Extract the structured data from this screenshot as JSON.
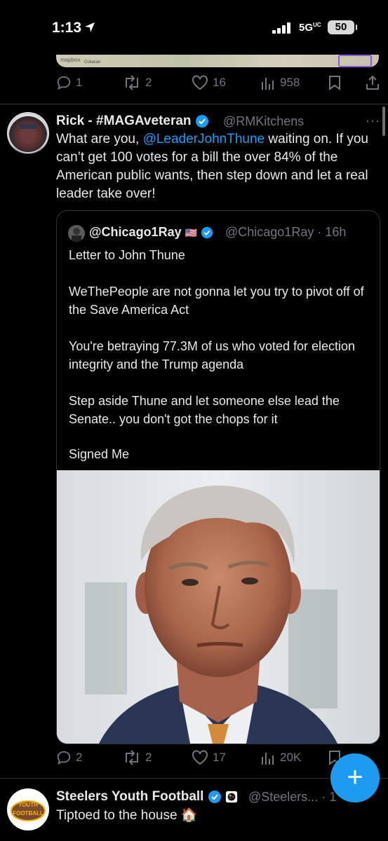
{
  "status_bar": {
    "time": "1:13",
    "network": "5G",
    "network_suffix": "UC",
    "battery": "50"
  },
  "map_preview": {
    "provider": "mapbox",
    "place": "Culiacán"
  },
  "tweet_prev_actions": {
    "replies": "1",
    "retweets": "2",
    "likes": "16",
    "views": "958"
  },
  "tweet": {
    "author_name": "Rick - #MAGAveteran",
    "handle": "@RMKitchens",
    "more": "···",
    "text_before": "What are you, ",
    "mention": "@LeaderJohnThune",
    "text_after": " waiting on. If you can’t get 100 votes for a bill the over 84% of the American public wants, then step down and let a real leader take over!",
    "quote": {
      "author_name": "@Chicago1Ray",
      "flag": "🇺🇸",
      "handle": "@Chicago1Ray",
      "time": "· 16h",
      "paragraphs": [
        "Letter to John Thune",
        "WeThePeople are not gonna let you try to pivot off of the Save America Act",
        "You're betraying 77.3M of us who voted for election integrity and the Trump agenda",
        "Step aside Thune and let someone else lead the Senate.. you don't got the chops for it",
        "Signed Me"
      ]
    },
    "actions": {
      "replies": "2",
      "retweets": "2",
      "likes": "17",
      "views": "20K"
    }
  },
  "next_tweet": {
    "author_name": "Steelers Youth Football",
    "handle": "@Steelers...",
    "time": "· 1",
    "text": "Tiptoed to the house 🏠",
    "avatar_text_top": "YOUTH",
    "avatar_text_bottom": "FOOTBALL"
  },
  "compose_button": {
    "label": "+"
  },
  "colors": {
    "accent": "#1d9bf0",
    "muted": "#71767b",
    "text": "#e7e9ea",
    "background": "#000000"
  }
}
